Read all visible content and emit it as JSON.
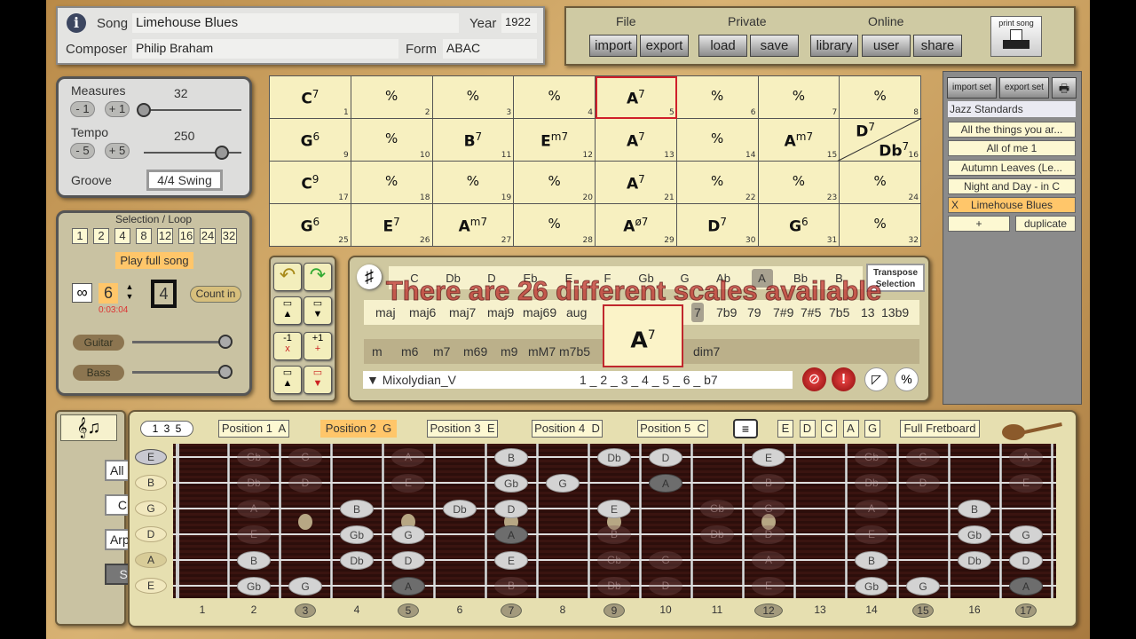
{
  "song": {
    "song_label": "Song",
    "title": "Limehouse Blues",
    "year_label": "Year",
    "year": "1922",
    "composer_label": "Composer",
    "composer": "Philip Braham",
    "form_label": "Form",
    "form": "ABAC"
  },
  "file": {
    "groups": [
      "File",
      "Private",
      "Online"
    ],
    "buttons": [
      "import",
      "export",
      "load",
      "save",
      "library",
      "user",
      "share"
    ],
    "print": "print song"
  },
  "controls": {
    "measures_label": "Measures",
    "measures": "32",
    "measures_fraction": 0.0,
    "minus1": "- 1",
    "plus1": "+ 1",
    "tempo_label": "Tempo",
    "tempo": "250",
    "tempo_fraction": 0.8,
    "minus5": "- 5",
    "plus5": "+ 5",
    "groove_label": "Groove",
    "groove": "4/4 Swing"
  },
  "selection": {
    "title": "Selection / Loop",
    "sizes": [
      "1",
      "2",
      "4",
      "8",
      "12",
      "16",
      "24",
      "32"
    ],
    "play_full": "Play full song",
    "loop_count": "6",
    "time": "0:03:04",
    "beats": "4",
    "count_in": "Count in",
    "guitar": "Guitar",
    "bass": "Bass",
    "guitar_level": 0.95,
    "bass_level": 0.95
  },
  "grid": {
    "selected": 5,
    "cells": [
      {
        "r": "C",
        "e": "7"
      },
      {
        "r": "%"
      },
      {
        "r": "%"
      },
      {
        "r": "%"
      },
      {
        "r": "A",
        "e": "7"
      },
      {
        "r": "%"
      },
      {
        "r": "%"
      },
      {
        "r": "%"
      },
      {
        "r": "G",
        "e": "6"
      },
      {
        "r": "%"
      },
      {
        "r": "B",
        "e": "7"
      },
      {
        "r": "E",
        "e": "m7"
      },
      {
        "r": "A",
        "e": "7"
      },
      {
        "r": "%"
      },
      {
        "r": "A",
        "e": "m7"
      },
      {
        "r": "D",
        "e": "7",
        "r2": "Db",
        "e2": "7"
      },
      {
        "r": "C",
        "e": "9"
      },
      {
        "r": "%"
      },
      {
        "r": "%"
      },
      {
        "r": "%"
      },
      {
        "r": "A",
        "e": "7"
      },
      {
        "r": "%"
      },
      {
        "r": "%"
      },
      {
        "r": "%"
      },
      {
        "r": "G",
        "e": "6"
      },
      {
        "r": "E",
        "e": "7"
      },
      {
        "r": "A",
        "e": "m7"
      },
      {
        "r": "%"
      },
      {
        "r": "A",
        "e": "ø7"
      },
      {
        "r": "D",
        "e": "7"
      },
      {
        "r": "G",
        "e": "6"
      },
      {
        "r": "%"
      }
    ]
  },
  "scale": {
    "sharp": "♯",
    "roots": [
      "C",
      "Db",
      "D",
      "Eb",
      "E",
      "F",
      "Gb",
      "G",
      "Ab",
      "A",
      "Bb",
      "B"
    ],
    "selected_root": "A",
    "transpose": "Transpose Selection",
    "overlay": "There are 26 different scales available",
    "qual_left1": [
      "maj",
      "maj6",
      "maj7",
      "maj9",
      "maj69",
      "aug"
    ],
    "qual_right1": [
      "7",
      "7b9",
      "79",
      "7#9",
      "7#5",
      "7b5",
      "13",
      "13b9"
    ],
    "qual_left2": [
      "m",
      "m6",
      "m7",
      "m69",
      "m9",
      "mM7",
      "m7b5"
    ],
    "qual_right2": [
      "dim7"
    ],
    "selected_quality": "7",
    "current_root": "A",
    "current_ext": "7",
    "scale_name": "Mixolydian_V",
    "degrees": "1 _ 2 _ 3 _ 4 _ 5 _ 6 _ b7"
  },
  "setlist": {
    "import": "import set",
    "export": "export set",
    "name": "Jazz Standards",
    "songs": [
      "All the things you ar...",
      "All of me 1",
      "Autumn Leaves (Le...",
      "Night and Day - in C",
      "Limehouse Blues"
    ],
    "active": 4,
    "remove": "X",
    "add": "+",
    "duplicate": "duplicate"
  },
  "modes": {
    "items": [
      "All Notes",
      "Chord",
      "Arpeggio",
      "Scale"
    ],
    "active": "Scale"
  },
  "fretbar": {
    "triad": "1 3 5",
    "positions": [
      "Position 1  A",
      "Position 2  G",
      "Position 3  E",
      "Position 4  D",
      "Position 5  C"
    ],
    "active_position": 1,
    "caged": [
      "E",
      "D",
      "C",
      "A",
      "G"
    ],
    "full": "Full Fretboard"
  },
  "fretboard": {
    "strings": [
      "E",
      "B",
      "G",
      "D",
      "A",
      "E"
    ],
    "fret_numbers": [
      1,
      2,
      3,
      4,
      5,
      6,
      7,
      8,
      9,
      10,
      11,
      12,
      13,
      14,
      15,
      16,
      17
    ],
    "marked_frets": [
      3,
      5,
      7,
      9,
      12,
      15,
      17
    ],
    "notes": [
      [
        [
          2,
          "Gb",
          "d"
        ],
        [
          3,
          "G",
          "d"
        ],
        [
          5,
          "A",
          "d"
        ],
        [
          7,
          "B",
          "a"
        ],
        [
          9,
          "Db",
          "a"
        ],
        [
          10,
          "D",
          "a"
        ],
        [
          12,
          "E",
          "a"
        ],
        [
          14,
          "Gb",
          "d"
        ],
        [
          15,
          "G",
          "d"
        ],
        [
          17,
          "A",
          "d"
        ]
      ],
      [
        [
          2,
          "Db",
          "d"
        ],
        [
          3,
          "D",
          "d"
        ],
        [
          5,
          "E",
          "d"
        ],
        [
          7,
          "Gb",
          "a"
        ],
        [
          8,
          "G",
          "a"
        ],
        [
          10,
          "A",
          "r"
        ],
        [
          12,
          "B",
          "d"
        ],
        [
          14,
          "Db",
          "d"
        ],
        [
          15,
          "D",
          "d"
        ],
        [
          17,
          "E",
          "d"
        ]
      ],
      [
        [
          2,
          "A",
          "d"
        ],
        [
          4,
          "B",
          "a"
        ],
        [
          6,
          "Db",
          "a"
        ],
        [
          7,
          "D",
          "a"
        ],
        [
          9,
          "E",
          "a"
        ],
        [
          11,
          "Gb",
          "d"
        ],
        [
          12,
          "G",
          "d"
        ],
        [
          14,
          "A",
          "d"
        ],
        [
          16,
          "B",
          "a"
        ]
      ],
      [
        [
          2,
          "E",
          "d"
        ],
        [
          4,
          "Gb",
          "a"
        ],
        [
          5,
          "G",
          "a"
        ],
        [
          7,
          "A",
          "r"
        ],
        [
          9,
          "B",
          "d"
        ],
        [
          11,
          "Db",
          "d"
        ],
        [
          12,
          "D",
          "d"
        ],
        [
          14,
          "E",
          "d"
        ],
        [
          16,
          "Gb",
          "a"
        ],
        [
          17,
          "G",
          "a"
        ]
      ],
      [
        [
          2,
          "B",
          "a"
        ],
        [
          4,
          "Db",
          "a"
        ],
        [
          5,
          "D",
          "a"
        ],
        [
          7,
          "E",
          "a"
        ],
        [
          9,
          "Gb",
          "d"
        ],
        [
          10,
          "G",
          "d"
        ],
        [
          12,
          "A",
          "d"
        ],
        [
          14,
          "B",
          "a"
        ],
        [
          16,
          "Db",
          "a"
        ],
        [
          17,
          "D",
          "a"
        ]
      ],
      [
        [
          2,
          "Gb",
          "a"
        ],
        [
          3,
          "G",
          "a"
        ],
        [
          5,
          "A",
          "r"
        ],
        [
          7,
          "B",
          "d"
        ],
        [
          9,
          "Db",
          "d"
        ],
        [
          10,
          "D",
          "d"
        ],
        [
          12,
          "E",
          "d"
        ],
        [
          14,
          "Gb",
          "a"
        ],
        [
          15,
          "G",
          "a"
        ],
        [
          17,
          "A",
          "r"
        ]
      ]
    ]
  },
  "colors": {
    "accent": "#ffc66a",
    "grid_bg": "#f7f0c0",
    "selected_border": "#d0202a",
    "fretboard": "#3a1410"
  }
}
